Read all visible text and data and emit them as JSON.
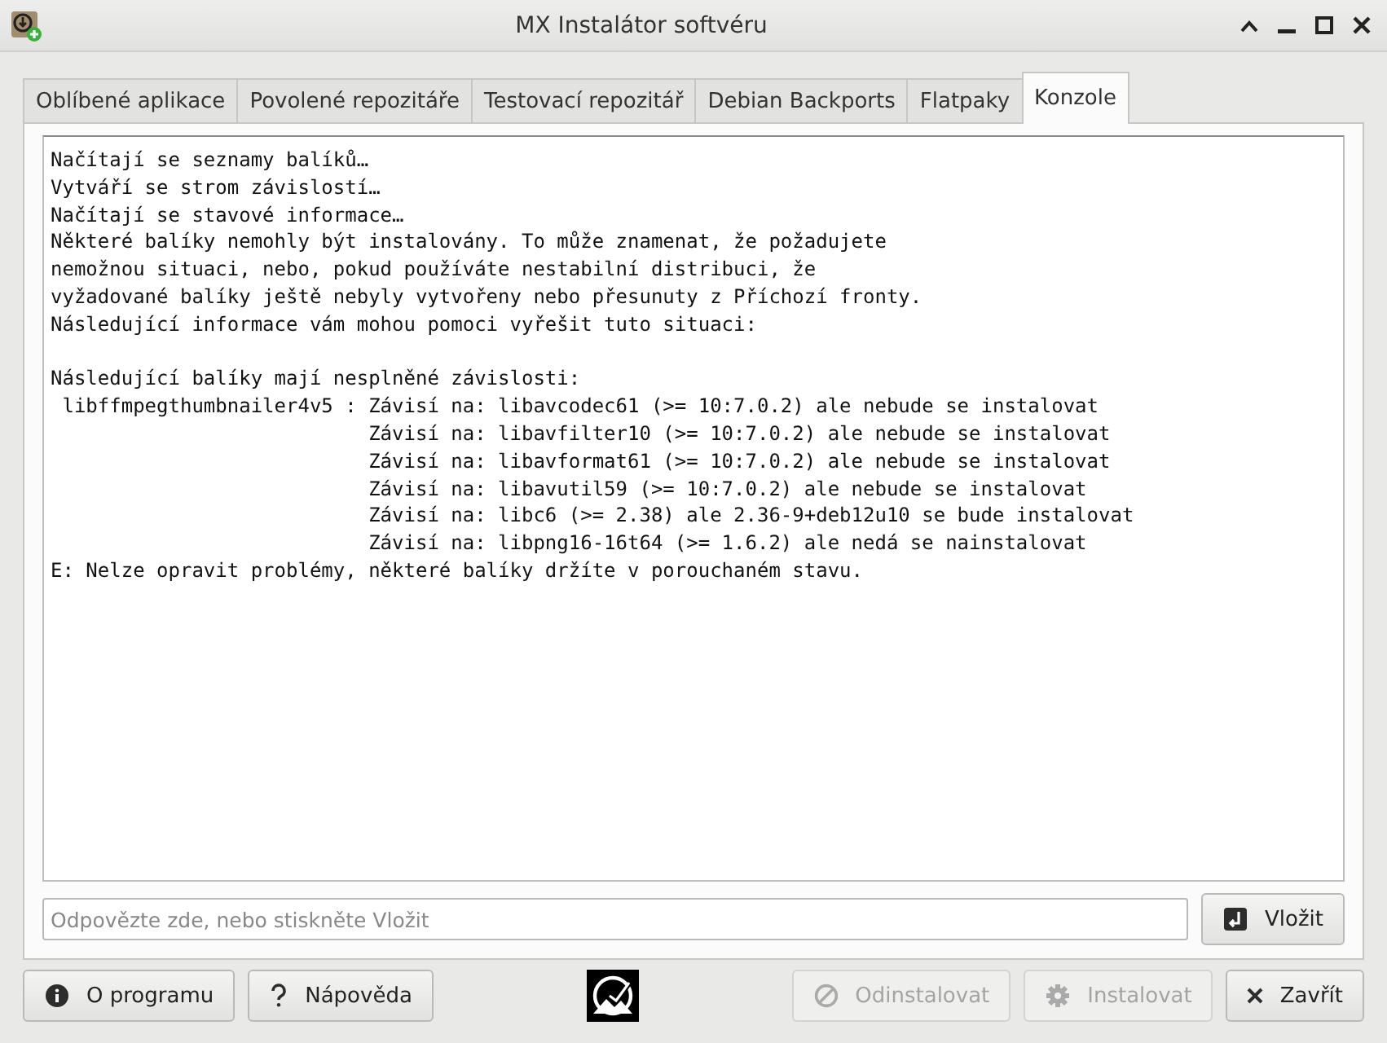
{
  "window": {
    "title": "MX Instalátor softvéru"
  },
  "tabs": [
    {
      "label": "Oblíbené aplikace",
      "selected": false
    },
    {
      "label": "Povolené repozitáře",
      "selected": false
    },
    {
      "label": "Testovací repozitář",
      "selected": false
    },
    {
      "label": "Debian Backports",
      "selected": false
    },
    {
      "label": "Flatpaky",
      "selected": false
    },
    {
      "label": "Konzole",
      "selected": true
    }
  ],
  "console": {
    "lines": [
      {
        "kind": "text",
        "text": "Načítají se seznamy balíků…"
      },
      {
        "kind": "text",
        "text": "Vytváří se strom závislostí…"
      },
      {
        "kind": "text",
        "text": "Načítají se stavové informace…"
      },
      {
        "kind": "text",
        "text": "Některé balíky nemohly být instalovány. To může znamenat, že požadujete"
      },
      {
        "kind": "text",
        "text": "nemožnou situaci, nebo, pokud používáte nestabilní distribuci, že"
      },
      {
        "kind": "text",
        "text": "vyžadované balíky ještě nebyly vytvořeny nebo přesunuty z Příchozí fronty."
      },
      {
        "kind": "text",
        "text": "Následující informace vám mohou pomoci vyřešit tuto situaci:"
      },
      {
        "kind": "blank"
      },
      {
        "kind": "text",
        "text": "Následující balíky mají nesplněné závislosti:"
      },
      {
        "kind": "text",
        "text": " libffmpegthumbnailer4v5 : Závisí na: libavcodec61 (>= 10:7.0.2) ale nebude se instalovat"
      },
      {
        "kind": "text",
        "text": "                           Závisí na: libavfilter10 (>= 10:7.0.2) ale nebude se instalovat"
      },
      {
        "kind": "text",
        "text": "                           Závisí na: libavformat61 (>= 10:7.0.2) ale nebude se instalovat"
      },
      {
        "kind": "text",
        "text": "                           Závisí na: libavutil59 (>= 10:7.0.2) ale nebude se instalovat"
      },
      {
        "kind": "text",
        "text": "                           Závisí na: libc6 (>= 2.38) ale 2.36-9+deb12u10 se bude instalovat"
      },
      {
        "kind": "text",
        "text": "                           Závisí na: libpng16-16t64 (>= 1.6.2) ale nedá se nainstalovat"
      },
      {
        "kind": "text",
        "text": "E: Nelze opravit problémy, některé balíky držíte v porouchaném stavu."
      }
    ]
  },
  "input": {
    "placeholder": "Odpovězte zde, nebo stiskněte Vložit"
  },
  "enter_button": {
    "label": "Vložit"
  },
  "buttons": [
    {
      "kind": "about",
      "label": "O programu",
      "disabled": false
    },
    {
      "kind": "help",
      "label": "Nápověda",
      "disabled": false
    },
    {
      "kind": "uninstall",
      "label": "Odinstalovat",
      "disabled": true
    },
    {
      "kind": "install",
      "label": "Instalovat",
      "disabled": true
    },
    {
      "kind": "close",
      "label": "Zavřít",
      "disabled": false
    }
  ]
}
